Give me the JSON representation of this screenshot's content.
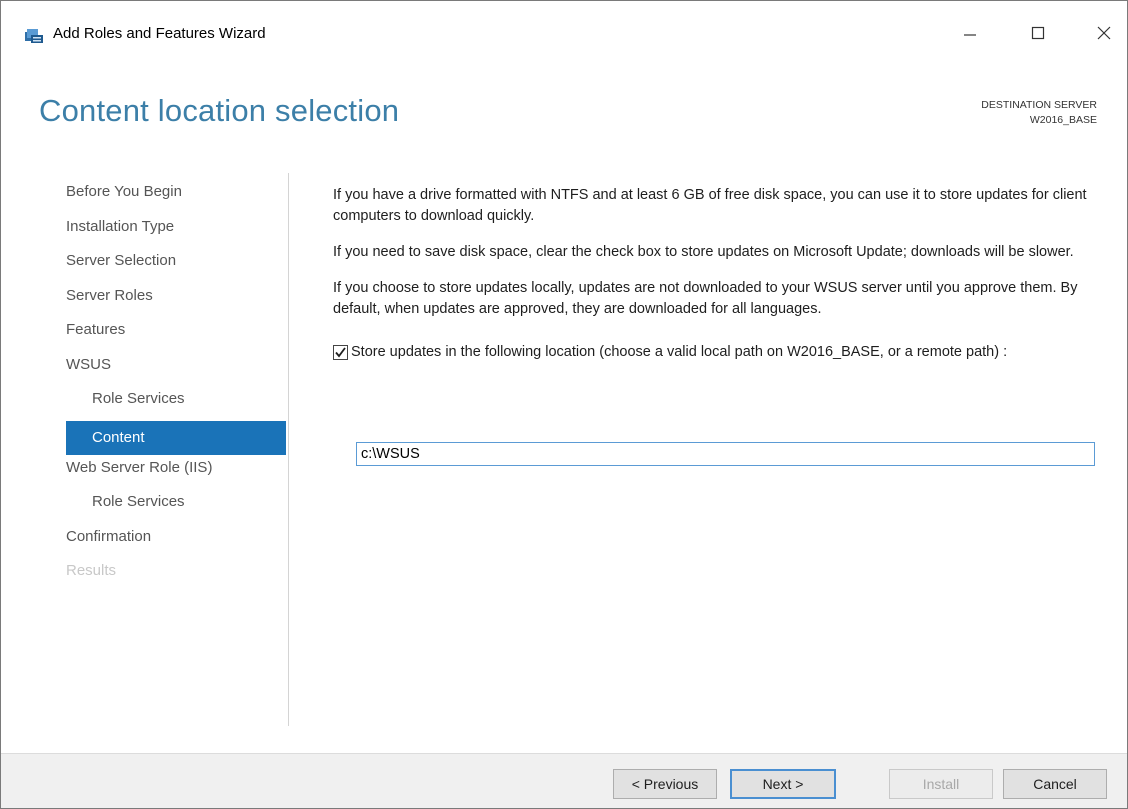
{
  "window": {
    "title": "Add Roles and Features Wizard"
  },
  "header": {
    "page_title": "Content location selection",
    "destination_label": "DESTINATION SERVER",
    "destination_server": "W2016_BASE"
  },
  "nav": {
    "items": [
      {
        "label": "Before You Begin"
      },
      {
        "label": "Installation Type"
      },
      {
        "label": "Server Selection"
      },
      {
        "label": "Server Roles"
      },
      {
        "label": "Features"
      },
      {
        "label": "WSUS"
      },
      {
        "label": "Role Services"
      },
      {
        "label": "Content"
      },
      {
        "label": "Web Server Role (IIS)"
      },
      {
        "label": "Role Services"
      },
      {
        "label": "Confirmation"
      },
      {
        "label": "Results"
      }
    ]
  },
  "content": {
    "paragraph1": "If you have a drive formatted with NTFS and at least 6 GB of free disk space, you can use it to store updates for client computers to download quickly.",
    "paragraph2": "If you need to save disk space, clear the check box to store updates on Microsoft Update; downloads will be slower.",
    "paragraph3": "If you choose to store updates locally, updates are not downloaded to your WSUS server until you approve them. By default, when updates are approved, they are downloaded for all languages.",
    "checkbox_label": "Store updates in the following location (choose a valid local path on W2016_BASE, or a remote path) :",
    "checkbox_checked": true,
    "path_value": "c:\\WSUS"
  },
  "footer": {
    "previous_label": "< Previous",
    "next_label": "Next >",
    "install_label": "Install",
    "cancel_label": "Cancel"
  },
  "colors": {
    "title_accent": "#3c7fa8",
    "nav_active": "#1a73b8"
  },
  "icons": {
    "app": "server-manager-icon",
    "minimize": "minimize-icon",
    "maximize": "maximize-icon",
    "close": "close-icon",
    "checkmark": "checkmark-icon"
  }
}
